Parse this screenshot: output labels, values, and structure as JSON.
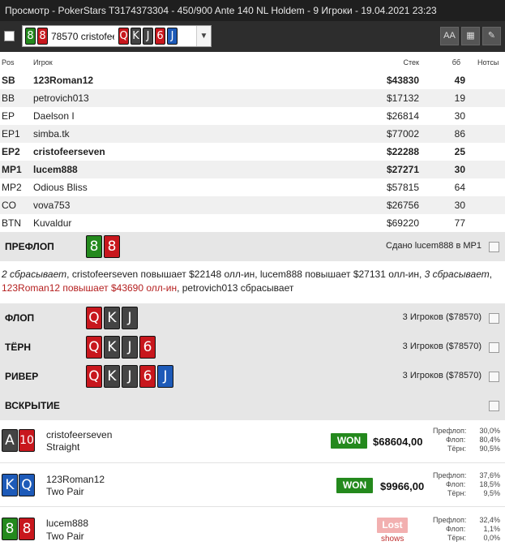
{
  "window": {
    "title": "Просмотр - PokerStars T3174373304 - 450/900 Ante 140 NL Holdem - 9 Игроки - 19.04.2021 23:23"
  },
  "selector": {
    "hole_cards": [
      {
        "rank": "8",
        "suit": "c"
      },
      {
        "rank": "8",
        "suit": "h"
      }
    ],
    "stack": "78570",
    "name": "cristofeerseven",
    "board": [
      {
        "rank": "Q",
        "suit": "h"
      },
      {
        "rank": "K",
        "suit": "s"
      },
      {
        "rank": "J",
        "suit": "s"
      },
      {
        "rank": "6",
        "suit": "h"
      },
      {
        "rank": "J",
        "suit": "d"
      }
    ]
  },
  "toolbar": {
    "font_label": "AA",
    "grid_label": "▦",
    "edit_label": "✎"
  },
  "players_header": {
    "pos": "Pos",
    "name": "Игрок",
    "stack": "Стек",
    "bb": "бб",
    "notes": "Нотсы"
  },
  "players": [
    {
      "pos": "SB",
      "name": "123Roman12",
      "stack": "$43830",
      "bb": "49",
      "bold": true
    },
    {
      "pos": "BB",
      "name": "petrovich013",
      "stack": "$17132",
      "bb": "19",
      "bold": false
    },
    {
      "pos": "EP",
      "name": "Daelson I",
      "stack": "$26814",
      "bb": "30",
      "bold": false
    },
    {
      "pos": "EP1",
      "name": "simba.tk",
      "stack": "$77002",
      "bb": "86",
      "bold": false
    },
    {
      "pos": "EP2",
      "name": "cristofeerseven",
      "stack": "$22288",
      "bb": "25",
      "bold": true
    },
    {
      "pos": "MP1",
      "name": "lucem888",
      "stack": "$27271",
      "bb": "30",
      "bold": true
    },
    {
      "pos": "MP2",
      "name": "Odious Bliss",
      "stack": "$57815",
      "bb": "64",
      "bold": false
    },
    {
      "pos": "CO",
      "name": "vova753",
      "stack": "$26756",
      "bb": "30",
      "bold": false
    },
    {
      "pos": "BTN",
      "name": "Kuvaldur",
      "stack": "$69220",
      "bb": "77",
      "bold": false
    }
  ],
  "preflop": {
    "label": "ПРЕФЛОП",
    "info": "Сдано lucem888 в MP1",
    "cards": [
      {
        "rank": "8",
        "suit": "c"
      },
      {
        "rank": "8",
        "suit": "h"
      }
    ]
  },
  "actions": {
    "a1": "2 сбрасывает",
    "a2": ", cristofeerseven повышает $22148 олл-ин, lucem888 повышает $27131 олл-ин, ",
    "a3": "3 сбрасывает",
    "a4": ",",
    "a5": "123Roman12 повышает $43690 олл-ин",
    "a6": ", petrovich013 сбрасывает"
  },
  "flop": {
    "label": "ФЛОП",
    "info": "3 Игроков ($78570)",
    "cards": [
      {
        "rank": "Q",
        "suit": "h"
      },
      {
        "rank": "K",
        "suit": "s"
      },
      {
        "rank": "J",
        "suit": "s"
      }
    ]
  },
  "turn": {
    "label": "ТЁРН",
    "info": "3 Игроков ($78570)",
    "cards": [
      {
        "rank": "Q",
        "suit": "h"
      },
      {
        "rank": "K",
        "suit": "s"
      },
      {
        "rank": "J",
        "suit": "s"
      },
      {
        "rank": "6",
        "suit": "h"
      }
    ]
  },
  "river": {
    "label": "РИВЕР",
    "info": "3 Игроков ($78570)",
    "cards": [
      {
        "rank": "Q",
        "suit": "h"
      },
      {
        "rank": "K",
        "suit": "s"
      },
      {
        "rank": "J",
        "suit": "s"
      },
      {
        "rank": "6",
        "suit": "h"
      },
      {
        "rank": "J",
        "suit": "d"
      }
    ]
  },
  "showdown": {
    "label": "ВСКРЫТИЕ"
  },
  "eq_labels": {
    "flop_pre": "Префлоп:",
    "flop": "Флоп:",
    "turn": "Тёрн:"
  },
  "results": [
    {
      "name": "cristofeerseven",
      "hand": "Straight",
      "status": "WON",
      "amount": "$68604,00",
      "shows": "",
      "cards": [
        {
          "rank": "A",
          "suit": "s"
        },
        {
          "rank": "10",
          "suit": "h"
        }
      ],
      "eq": [
        "30,0%",
        "80,4%",
        "90,5%"
      ]
    },
    {
      "name": "123Roman12",
      "hand": "Two Pair",
      "status": "WON",
      "amount": "$9966,00",
      "shows": "",
      "cards": [
        {
          "rank": "K",
          "suit": "d"
        },
        {
          "rank": "Q",
          "suit": "d"
        }
      ],
      "eq": [
        "37,6%",
        "18,5%",
        "9,5%"
      ]
    },
    {
      "name": "lucem888",
      "hand": "Two Pair",
      "status": "Lost",
      "amount": "",
      "shows": "shows",
      "cards": [
        {
          "rank": "8",
          "suit": "c"
        },
        {
          "rank": "8",
          "suit": "h"
        }
      ],
      "eq": [
        "32,4%",
        "1,1%",
        "0,0%"
      ]
    }
  ],
  "colors": {
    "spade": "#444444",
    "heart": "#c8171d",
    "club": "#24891d",
    "diamond": "#1d5ab8",
    "won": "#24891d",
    "lost": "#f2b0b0"
  }
}
